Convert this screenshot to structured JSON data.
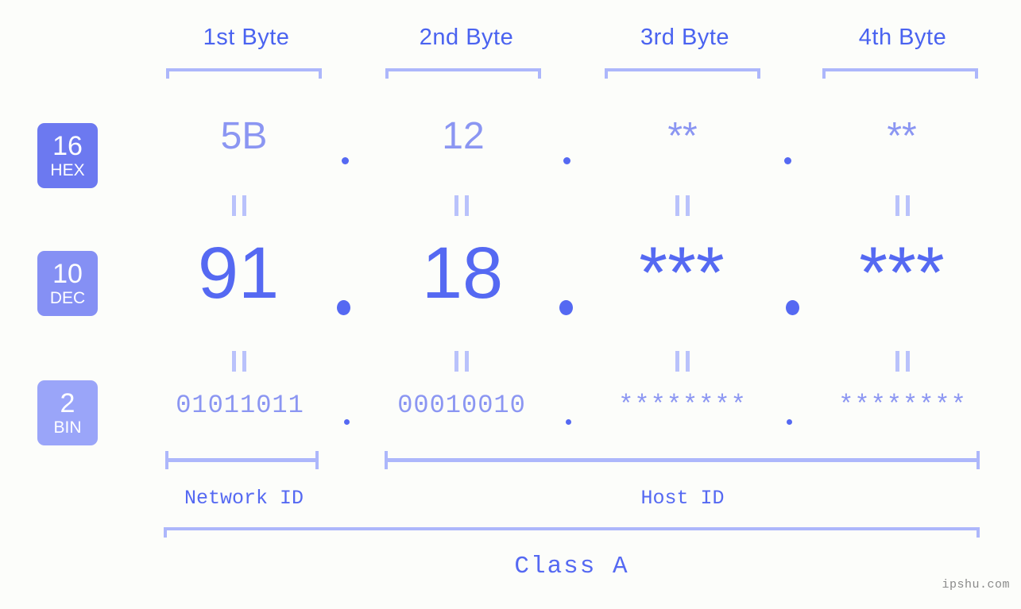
{
  "meta": {
    "background_color": "#fcfdfa",
    "accent_color": "#5569f2",
    "accent_light_color": "#adb7fb",
    "value_color": "#8b96f2"
  },
  "byte_headers": [
    {
      "label": "1st Byte"
    },
    {
      "label": "2nd Byte"
    },
    {
      "label": "3rd Byte"
    },
    {
      "label": "4th Byte"
    }
  ],
  "bases": [
    {
      "number": "16",
      "name": "HEX",
      "color": "#6c79f0"
    },
    {
      "number": "10",
      "name": "DEC",
      "color": "#8590f4"
    },
    {
      "number": "2",
      "name": "BIN",
      "color": "#9aa5f9"
    }
  ],
  "rows": {
    "hex": {
      "values": [
        "5B",
        "12",
        "**",
        "**"
      ]
    },
    "dec": {
      "values": [
        "91",
        "18",
        "***",
        "***"
      ]
    },
    "bin": {
      "values": [
        "01011011",
        "00010010",
        "********",
        "********"
      ]
    }
  },
  "separators": {
    "dot": ".",
    "equals": "||"
  },
  "footer": {
    "network_id_label": "Network ID",
    "host_id_label": "Host ID",
    "class_label": "Class A"
  },
  "watermark": {
    "text": "ipshu.com"
  }
}
